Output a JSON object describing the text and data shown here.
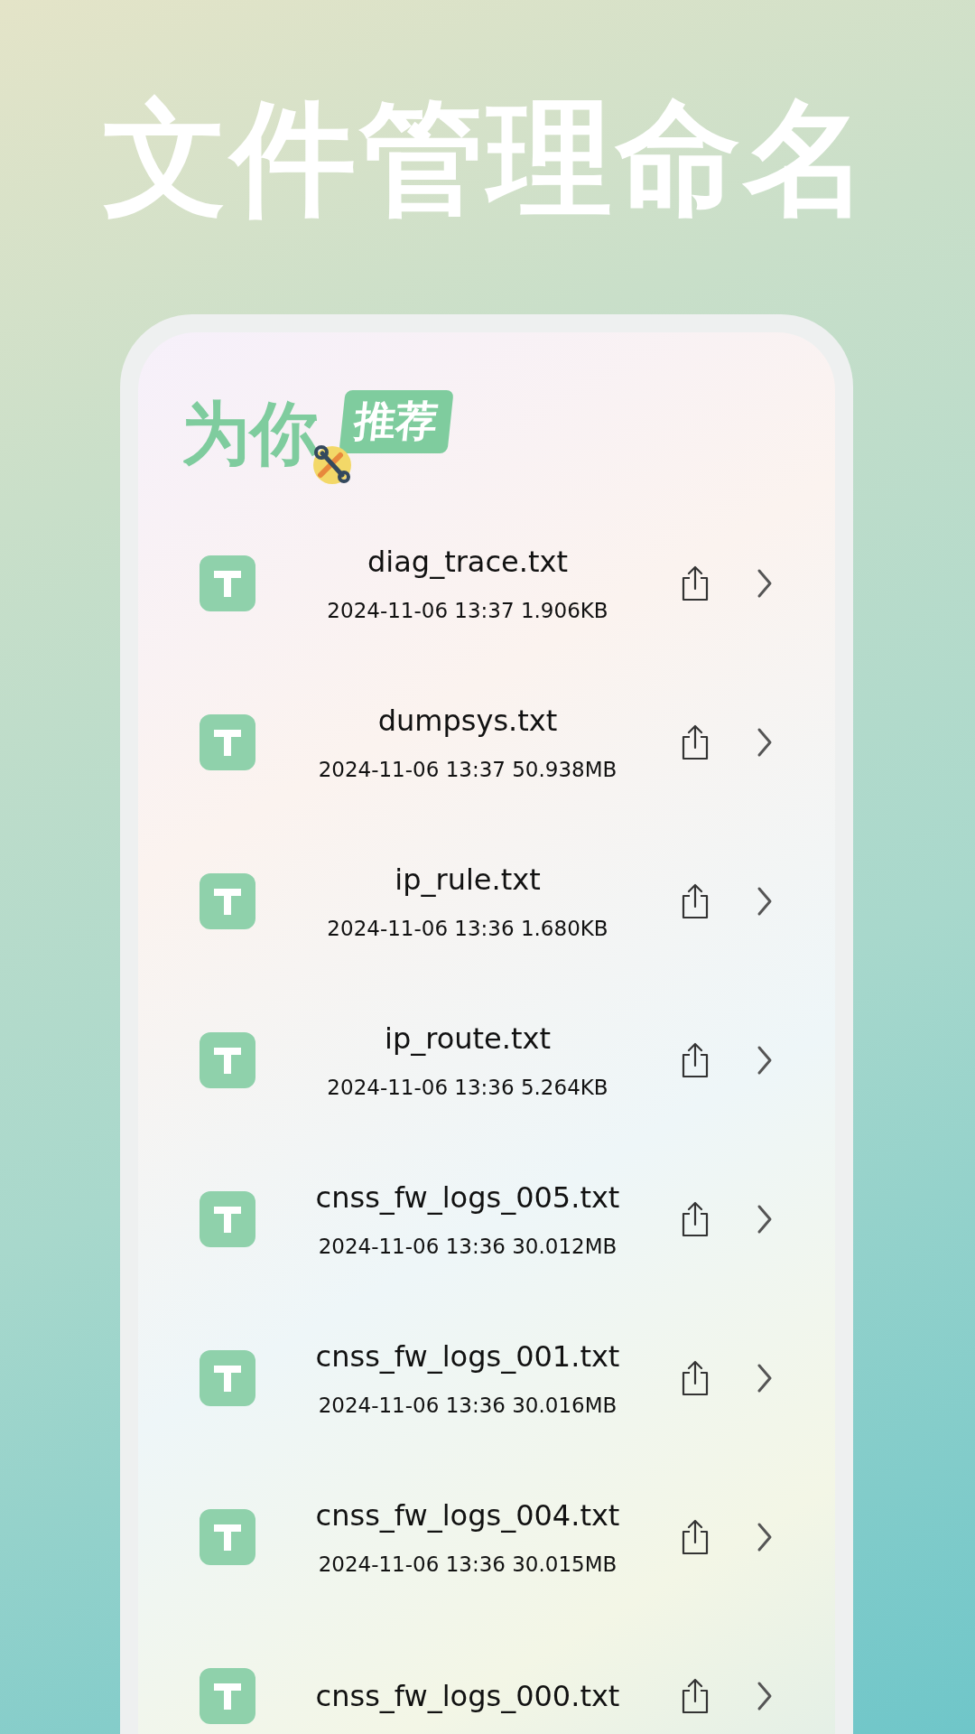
{
  "headline": "文件管理命名",
  "section": {
    "title": "为你",
    "tag": "推荐"
  },
  "files": [
    {
      "name": "diag_trace.txt",
      "meta": "2024-11-06 13:37 1.906KB"
    },
    {
      "name": "dumpsys.txt",
      "meta": "2024-11-06 13:37 50.938MB"
    },
    {
      "name": "ip_rule.txt",
      "meta": "2024-11-06 13:36 1.680KB"
    },
    {
      "name": "ip_route.txt",
      "meta": "2024-11-06 13:36 5.264KB"
    },
    {
      "name": "cnss_fw_logs_005.txt",
      "meta": "2024-11-06 13:36 30.012MB"
    },
    {
      "name": "cnss_fw_logs_001.txt",
      "meta": "2024-11-06 13:36 30.016MB"
    },
    {
      "name": "cnss_fw_logs_004.txt",
      "meta": "2024-11-06 13:36 30.015MB"
    },
    {
      "name": "cnss_fw_logs_000.txt"
    }
  ]
}
